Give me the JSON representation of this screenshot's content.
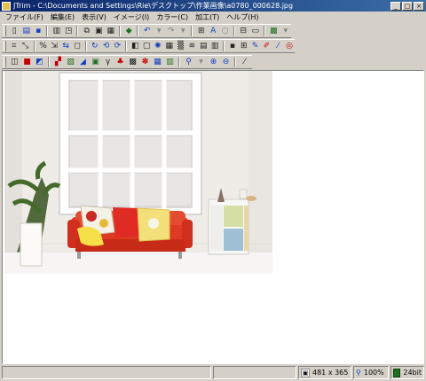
{
  "window": {
    "title": "JTrim - C:\\Documents and Settings\\Rie\\デスクトップ\\作業画像\\a0780_000628.jpg",
    "minimize": "_",
    "maximize": "□",
    "close": "×"
  },
  "menu": [
    "ファイル(F)",
    "編集(E)",
    "表示(V)",
    "イメージ(I)",
    "カラー(C)",
    "加工(T)",
    "ヘルプ(H)"
  ],
  "status": {
    "size": "481 x 365",
    "zoom": "100%",
    "depth": "24bit"
  }
}
